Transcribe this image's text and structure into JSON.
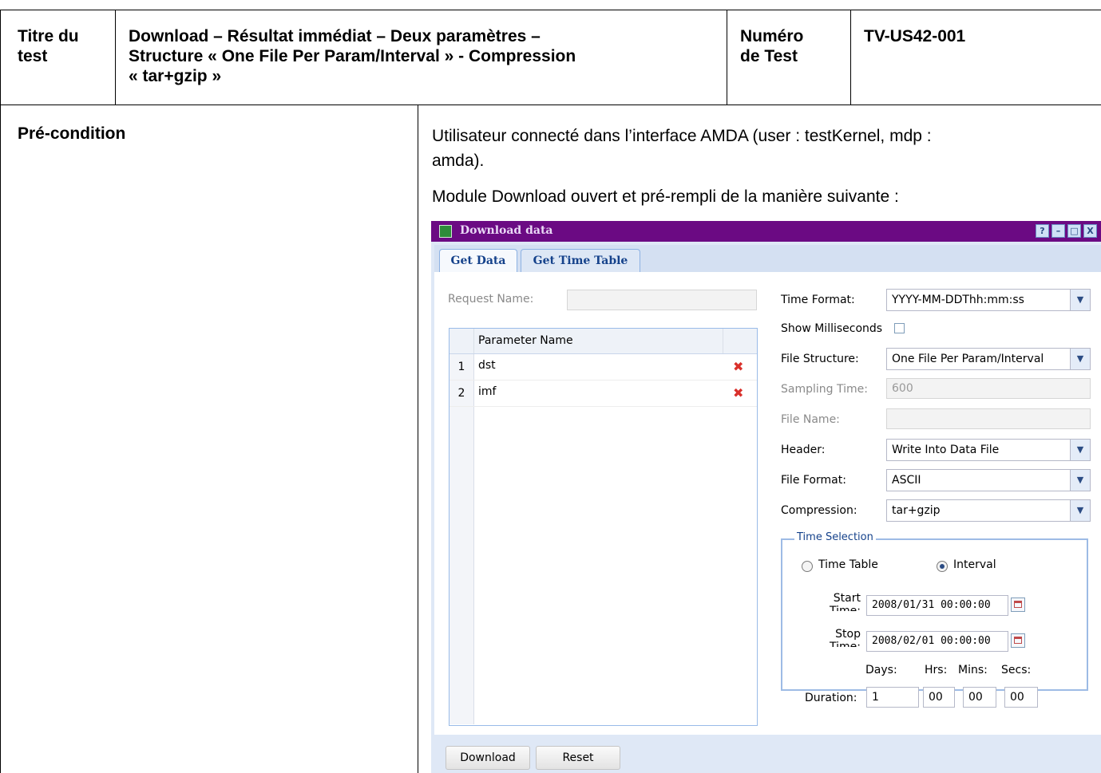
{
  "header": {
    "title_label": "Titre du test",
    "title_label_l1": "Titre du",
    "title_label_l2": "test",
    "title_value_l1": "Download – Résultat immédiat – Deux paramètres –",
    "title_value_l2": "Structure « One File Per Param/Interval » - Compression",
    "title_value_l3": "« tar+gzip »",
    "number_label_l1": "Numéro",
    "number_label_l2": "de Test",
    "number_value": "TV-US42-001"
  },
  "precondition": {
    "label": "Pré-condition",
    "para1_l1": "Utilisateur connecté dans l’interface AMDA (user : testKernel, mdp :",
    "para1_l2": "amda).",
    "para2": "Module Download ouvert et pré-rempli de la manière suivante :"
  },
  "window": {
    "title": "Download data",
    "tools": {
      "help": "?",
      "minimize": "–",
      "maximize": "□",
      "close": "X"
    },
    "tabs": [
      {
        "label": "Get Data",
        "active": true
      },
      {
        "label": "Get Time Table",
        "active": false
      }
    ],
    "request_name": {
      "label": "Request Name:",
      "value": ""
    },
    "grid": {
      "header": "Parameter Name",
      "rows": [
        {
          "num": "1",
          "name": "dst"
        },
        {
          "num": "2",
          "name": "imf"
        }
      ]
    },
    "time_format": {
      "label": "Time Format:",
      "value": "YYYY-MM-DDThh:mm:ss"
    },
    "show_ms": {
      "label": "Show Milliseconds",
      "checked": false
    },
    "file_structure": {
      "label": "File Structure:",
      "value": "One File Per Param/Interval"
    },
    "sampling_time": {
      "label": "Sampling Time:",
      "value": "600"
    },
    "file_name": {
      "label": "File Name:",
      "value": ""
    },
    "header": {
      "label": "Header:",
      "value": "Write Into Data File"
    },
    "file_format": {
      "label": "File Format:",
      "value": "ASCII"
    },
    "compression": {
      "label": "Compression:",
      "value": "tar+gzip"
    },
    "time_selection": {
      "legend": "Time Selection",
      "time_table_label": "Time Table",
      "interval_label": "Interval",
      "selected": "Interval",
      "start_label_l1": "Start",
      "start_label_l2": "Time:",
      "start_value": "2008/01/31 00:00:00",
      "stop_label_l1": "Stop",
      "stop_label_l2": "Time:",
      "stop_value": "2008/02/01 00:00:00",
      "days_label": "Days:",
      "hrs_label": "Hrs:",
      "mins_label": "Mins:",
      "secs_label": "Secs:",
      "duration_label": "Duration:",
      "days": "1",
      "hrs": "00",
      "mins": "00",
      "secs": "00"
    },
    "buttons": {
      "download": "Download",
      "reset": "Reset"
    }
  }
}
